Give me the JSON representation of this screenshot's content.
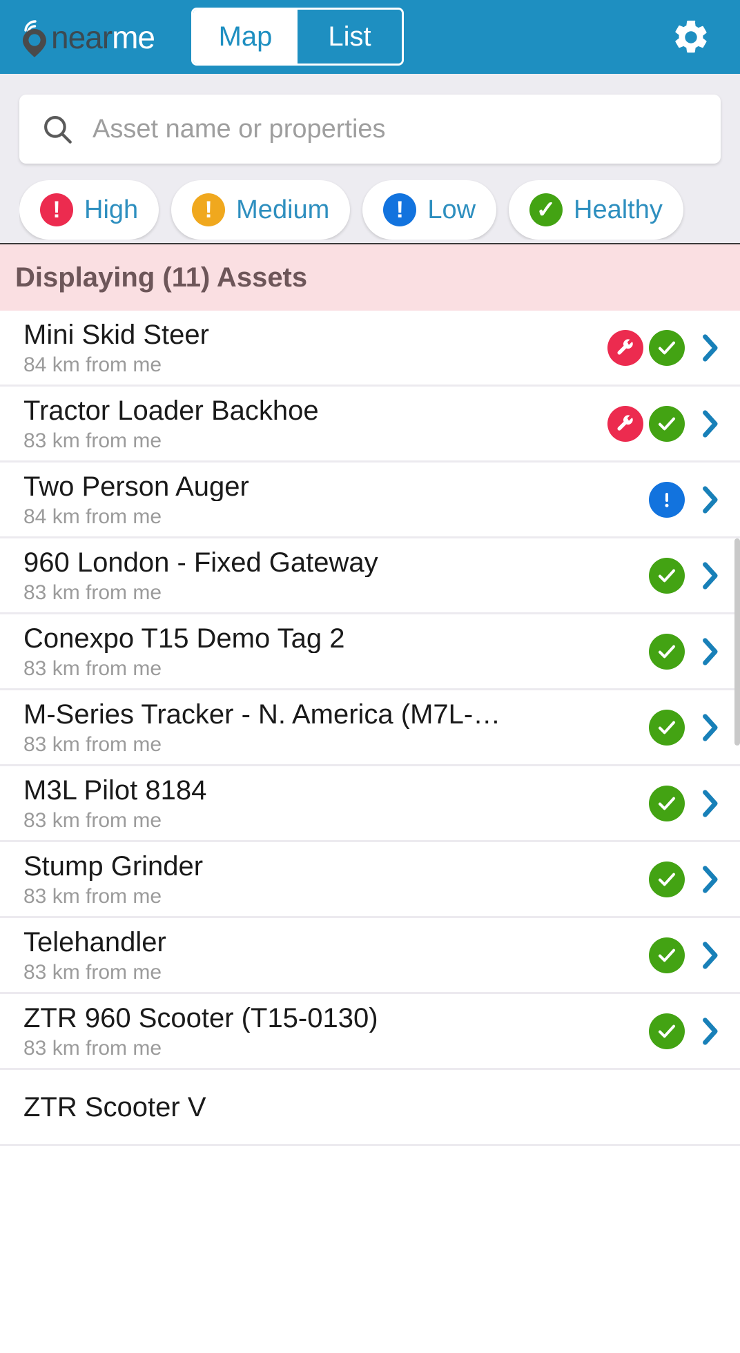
{
  "header": {
    "logo_near": "near",
    "logo_me": "me",
    "tabs": [
      {
        "label": "Map",
        "active": false
      },
      {
        "label": "List",
        "active": true
      }
    ],
    "settings_icon": "gear-icon"
  },
  "search": {
    "placeholder": "Asset name or properties",
    "value": "",
    "icon": "search-icon"
  },
  "filters": [
    {
      "label": "High",
      "color": "#ec2b4f",
      "glyph": "!"
    },
    {
      "label": "Medium",
      "color": "#f0a81e",
      "glyph": "!"
    },
    {
      "label": "Low",
      "color": "#1273de",
      "glyph": "!"
    },
    {
      "label": "Healthy",
      "color": "#43a313",
      "glyph": "✓"
    }
  ],
  "banner": {
    "text": "Displaying (11) Assets",
    "count": 11,
    "background": "#fadfe2"
  },
  "colors": {
    "brand": "#1e8fc1",
    "accent_link": "#2e8fbf",
    "alert_red": "#ec2b4f",
    "ok_green": "#43a313",
    "info_blue": "#1273de",
    "chevron": "#1880b8"
  },
  "assets": [
    {
      "name": "Mini Skid Steer",
      "distance": "84 km from me",
      "badges": [
        "wrench-red",
        "check-green"
      ]
    },
    {
      "name": "Tractor Loader Backhoe",
      "distance": "83 km from me",
      "badges": [
        "wrench-red",
        "check-green"
      ]
    },
    {
      "name": "Two Person Auger",
      "distance": "84 km from me",
      "badges": [
        "alert-blue"
      ]
    },
    {
      "name": "960 London - Fixed Gateway",
      "distance": "83 km from me",
      "badges": [
        "check-green"
      ]
    },
    {
      "name": "Conexpo T15 Demo Tag 2",
      "distance": "83 km from me",
      "badges": [
        "check-green"
      ]
    },
    {
      "name": "M-Series Tracker - N. America (M7L-…",
      "distance": "83 km from me",
      "badges": [
        "check-green"
      ]
    },
    {
      "name": "M3L Pilot 8184",
      "distance": "83 km from me",
      "badges": [
        "check-green"
      ]
    },
    {
      "name": "Stump Grinder",
      "distance": "83 km from me",
      "badges": [
        "check-green"
      ]
    },
    {
      "name": "Telehandler",
      "distance": "83 km from me",
      "badges": [
        "check-green"
      ]
    },
    {
      "name": "ZTR 960 Scooter (T15-0130)",
      "distance": "83 km from me",
      "badges": [
        "check-green"
      ]
    },
    {
      "name": "ZTR Scooter V",
      "distance": "",
      "badges": []
    }
  ]
}
